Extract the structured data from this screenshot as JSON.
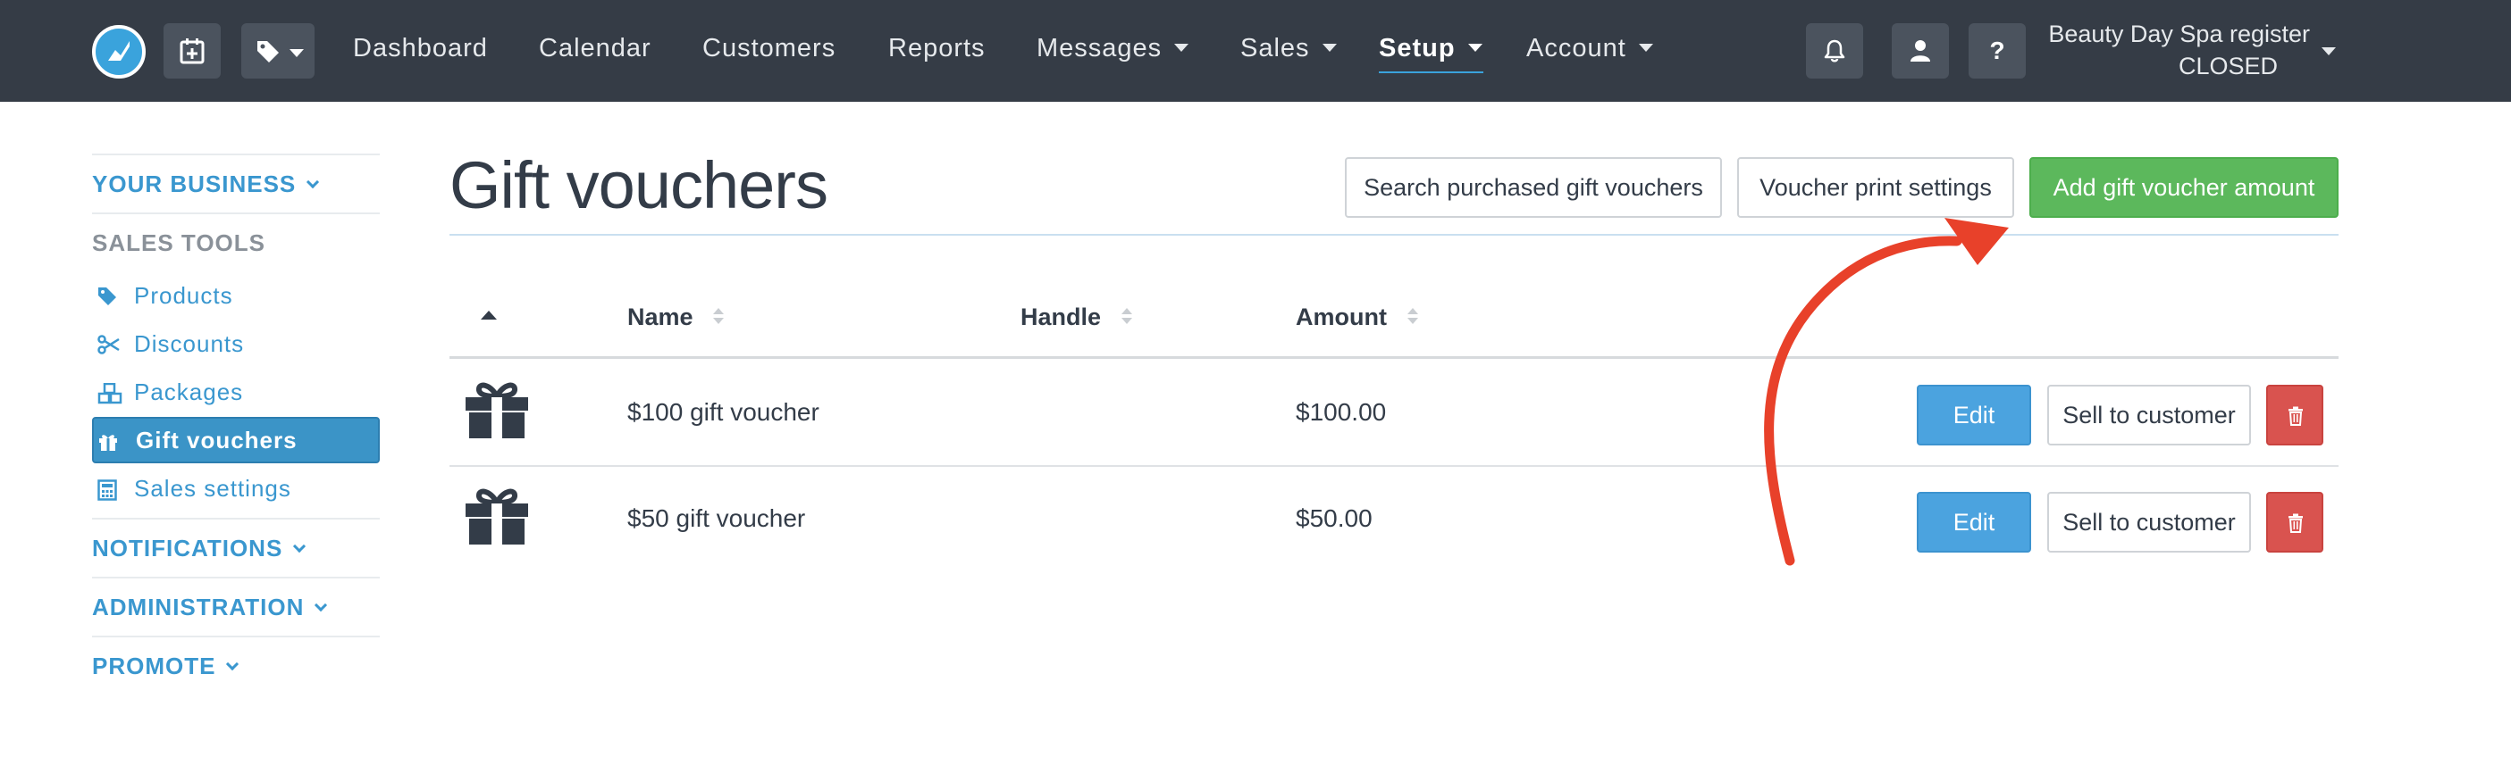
{
  "nav": {
    "items": [
      {
        "label": "Dashboard"
      },
      {
        "label": "Calendar"
      },
      {
        "label": "Customers"
      },
      {
        "label": "Reports"
      },
      {
        "label": "Messages"
      },
      {
        "label": "Sales"
      },
      {
        "label": "Setup"
      },
      {
        "label": "Account"
      }
    ],
    "register_name": "Beauty Day Spa register",
    "register_status": "CLOSED",
    "icons": [
      "logo-icon",
      "calendar-add-icon",
      "tag-icon",
      "bell-icon",
      "user-icon",
      "help-icon"
    ]
  },
  "sidebar": {
    "your_business": "YOUR BUSINESS",
    "sales_tools": "SALES TOOLS",
    "items": [
      {
        "label": "Products",
        "icon": "tag-icon"
      },
      {
        "label": "Discounts",
        "icon": "scissors-icon"
      },
      {
        "label": "Packages",
        "icon": "cubes-icon"
      },
      {
        "label": "Gift vouchers",
        "icon": "gift-icon"
      },
      {
        "label": "Sales settings",
        "icon": "calculator-icon"
      }
    ],
    "notifications": "NOTIFICATIONS",
    "administration": "ADMINISTRATION",
    "promote": "PROMOTE"
  },
  "page": {
    "title": "Gift vouchers",
    "search_button": "Search purchased gift vouchers",
    "print_button": "Voucher print settings",
    "add_button": "Add gift voucher amount"
  },
  "table": {
    "columns": [
      "Name",
      "Handle",
      "Amount"
    ],
    "rows": [
      {
        "name": "$100 gift voucher",
        "handle": "",
        "amount": "$100.00"
      },
      {
        "name": "$50 gift voucher",
        "handle": "",
        "amount": "$50.00"
      }
    ],
    "edit_label": "Edit",
    "sell_label": "Sell to customer"
  },
  "colors": {
    "topbar": "#353c46",
    "accent": "#3a97cf",
    "success": "#5cb85c",
    "danger": "#d9534f",
    "annotation_arrow": "#e8412a"
  }
}
